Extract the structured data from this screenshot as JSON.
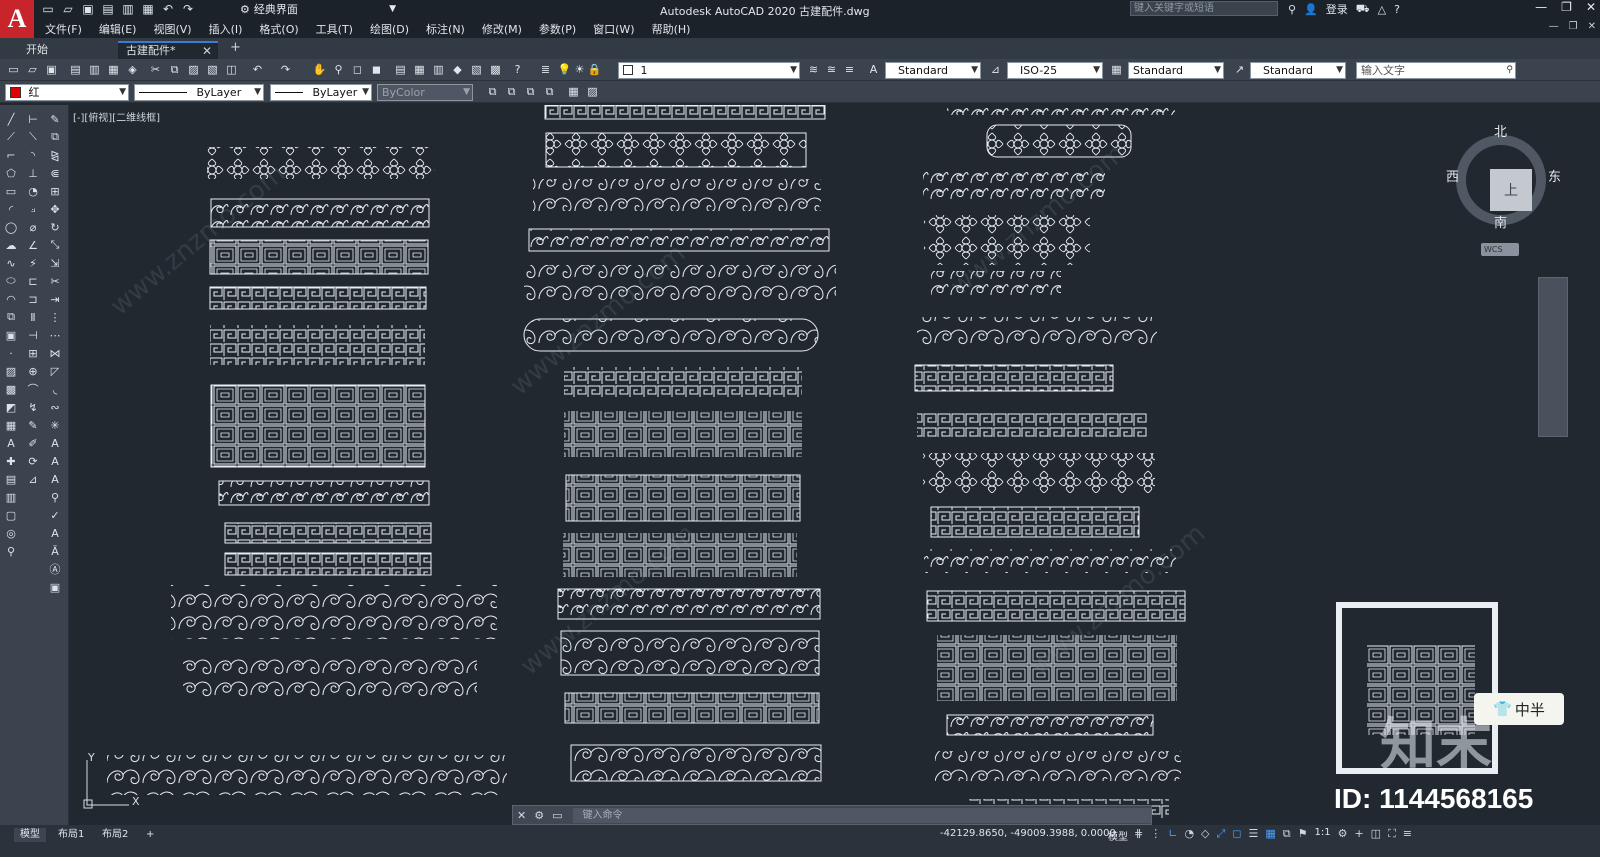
{
  "app": {
    "logo": "A",
    "title": "Autodesk AutoCAD 2020    古建配件.dwg",
    "workspace": "经典界面",
    "search_placeholder": "键入关键字或短语",
    "login": "登录"
  },
  "menu": [
    "文件(F)",
    "编辑(E)",
    "视图(V)",
    "插入(I)",
    "格式(O)",
    "工具(T)",
    "绘图(D)",
    "标注(N)",
    "修改(M)",
    "参数(P)",
    "窗口(W)",
    "帮助(H)"
  ],
  "tabs": {
    "start": "开始",
    "active": "古建配件*"
  },
  "toolbar1": {
    "layer_value": "1",
    "text_style": "Standard",
    "dim_style": "ISO-25",
    "table_style": "Standard",
    "mleader_style": "Standard",
    "find_placeholder": "输入文字"
  },
  "toolbar2": {
    "color": "红",
    "linetype": "ByLayer",
    "lineweight": "ByLayer",
    "plotstyle": "ByColor"
  },
  "viewport_label": "[-][俯视][二维线框]",
  "viewcube": {
    "north": "北",
    "south": "南",
    "east": "东",
    "west": "西",
    "top": "上",
    "wcs": "WCS"
  },
  "ucs": {
    "x": "X",
    "y": "Y"
  },
  "command_placeholder": "键入命令",
  "status": {
    "tabs": [
      "模型",
      "布局1",
      "布局2"
    ],
    "coords": "-42129.8650, -49009.3988, 0.0000",
    "mode": "模型",
    "scale": "1:1"
  },
  "watermark": {
    "logo": "知末",
    "id": "ID: 1144568165",
    "ime": "中半"
  },
  "colors": {
    "accent": "#3a7bd5",
    "canvas": "#212830",
    "logo": "#c8242b"
  }
}
